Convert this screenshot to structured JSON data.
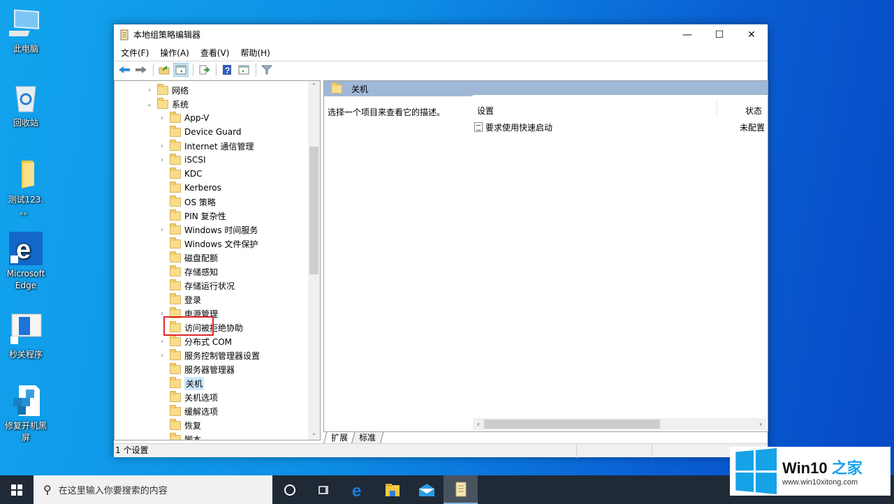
{
  "desktop": {
    "icons": [
      {
        "label": "此电脑",
        "icon": "computer-icon"
      },
      {
        "label": "回收站",
        "icon": "recycle-bin-icon"
      },
      {
        "label": "测试123.",
        "label2": "。。",
        "icon": "folder-icon"
      },
      {
        "label": "Microsoft",
        "label2": "Edge",
        "icon": "edge-icon"
      },
      {
        "label": "秒关程序",
        "icon": "app-shortcut-icon"
      },
      {
        "label": "修复开机黑",
        "label2": "屏",
        "icon": "registry-icon"
      }
    ]
  },
  "window": {
    "title": "本地组策略编辑器",
    "controls": {
      "minimize": "—",
      "maximize": "☐",
      "close": "✕"
    },
    "menu": [
      "文件(F)",
      "操作(A)",
      "查看(V)",
      "帮助(H)"
    ],
    "toolbar": [
      "back-icon",
      "forward-icon",
      "up-folder-icon",
      "show-hide-tree-icon",
      "export-list-icon",
      "help-icon",
      "show-action-pane-icon",
      "filter-icon"
    ]
  },
  "tree": {
    "items": [
      {
        "label": "网络",
        "level": 0,
        "expander": "›"
      },
      {
        "label": "系统",
        "level": 0,
        "expander": "⌄"
      },
      {
        "label": "App-V",
        "level": 1,
        "expander": "›"
      },
      {
        "label": "Device Guard",
        "level": 1,
        "expander": ""
      },
      {
        "label": "Internet 通信管理",
        "level": 1,
        "expander": "›"
      },
      {
        "label": "iSCSI",
        "level": 1,
        "expander": "›"
      },
      {
        "label": "KDC",
        "level": 1,
        "expander": ""
      },
      {
        "label": "Kerberos",
        "level": 1,
        "expander": ""
      },
      {
        "label": "OS 策略",
        "level": 1,
        "expander": ""
      },
      {
        "label": "PIN 复杂性",
        "level": 1,
        "expander": ""
      },
      {
        "label": "Windows 时间服务",
        "level": 1,
        "expander": "›"
      },
      {
        "label": "Windows 文件保护",
        "level": 1,
        "expander": ""
      },
      {
        "label": "磁盘配额",
        "level": 1,
        "expander": ""
      },
      {
        "label": "存储感知",
        "level": 1,
        "expander": ""
      },
      {
        "label": "存储运行状况",
        "level": 1,
        "expander": ""
      },
      {
        "label": "登录",
        "level": 1,
        "expander": ""
      },
      {
        "label": "电源管理",
        "level": 1,
        "expander": "›"
      },
      {
        "label": "访问被拒绝协助",
        "level": 1,
        "expander": ""
      },
      {
        "label": "分布式 COM",
        "level": 1,
        "expander": "›"
      },
      {
        "label": "服务控制管理器设置",
        "level": 1,
        "expander": "›"
      },
      {
        "label": "服务器管理器",
        "level": 1,
        "expander": ""
      },
      {
        "label": "关机",
        "level": 1,
        "expander": "",
        "selected": true
      },
      {
        "label": "关机选项",
        "level": 1,
        "expander": ""
      },
      {
        "label": "缓解选项",
        "level": 1,
        "expander": ""
      },
      {
        "label": "恢复",
        "level": 1,
        "expander": ""
      },
      {
        "label": "脚本",
        "level": 1,
        "expander": ""
      }
    ],
    "scroll_up": "⌃",
    "scroll_down": "⌄"
  },
  "details": {
    "header": "关机",
    "description": "选择一个项目来查看它的描述。",
    "columns": {
      "setting": "设置",
      "state": "状态"
    },
    "rows": [
      {
        "setting": "要求使用快速启动",
        "state": "未配置"
      }
    ],
    "hscroll_left": "‹",
    "hscroll_right": "›"
  },
  "tabs": [
    "扩展",
    "标准"
  ],
  "status": "1 个设置",
  "taskbar": {
    "search_placeholder": "在这里输入你要搜索的内容",
    "apps": [
      "cortana-icon",
      "task-view-icon",
      "edge-icon",
      "file-explorer-icon",
      "mail-icon",
      "group-policy-icon"
    ]
  },
  "watermark": {
    "title": "Win10",
    "title_accent": "之家",
    "url": "www.win10xitong.com"
  },
  "colors": {
    "accent": "#16a2e7",
    "header_band": "#9fb8d6",
    "highlight": "#e0262b",
    "taskbar": "#1f2a36"
  }
}
